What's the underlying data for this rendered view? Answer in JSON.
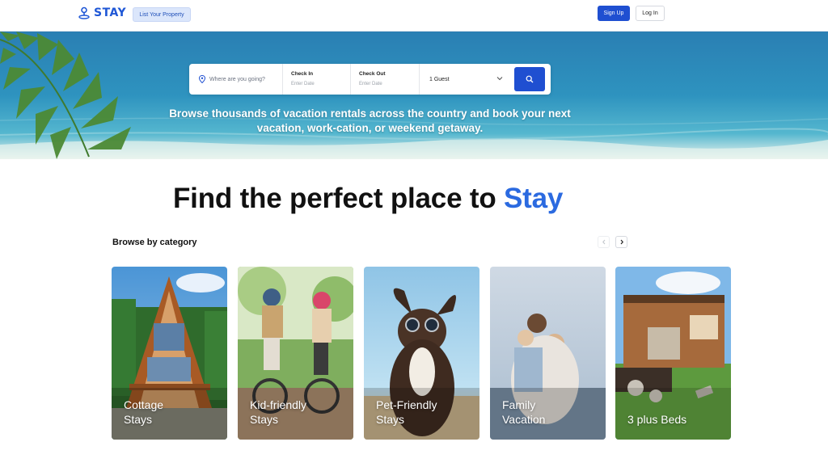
{
  "header": {
    "logo_text": "STAY",
    "list_property_label": "List Your Property",
    "signup_label": "Sign Up",
    "login_label": "Log In"
  },
  "search": {
    "where_placeholder": "Where are you going?",
    "checkin_label": "Check In",
    "checkin_placeholder": "Enter Date",
    "checkout_label": "Check Out",
    "checkout_placeholder": "Enter Date",
    "guests_value": "1 Guest"
  },
  "hero": {
    "tagline": "Browse thousands of vacation rentals across the country and book your next vacation, work-cation, or weekend getaway."
  },
  "main": {
    "headline": "Find the perfect place to",
    "headline_accent": "Stay",
    "browse_title": "Browse by category",
    "categories": [
      {
        "label": "Cottage Stays"
      },
      {
        "label": "Kid-friendly Stays"
      },
      {
        "label": "Pet-Friendly Stays"
      },
      {
        "label": "Family Vacation"
      },
      {
        "label": "3 plus Beds"
      }
    ]
  },
  "icons": {
    "logo": "map-pin-person-icon",
    "location": "location-pin-icon",
    "chevron": "chevron-down-icon",
    "search": "search-icon",
    "prev": "chevron-left-icon",
    "next": "chevron-right-icon"
  },
  "colors": {
    "brand": "#1f4fd1",
    "accent_text": "#2b6ae0",
    "list_button_bg": "#dbe6fb"
  }
}
